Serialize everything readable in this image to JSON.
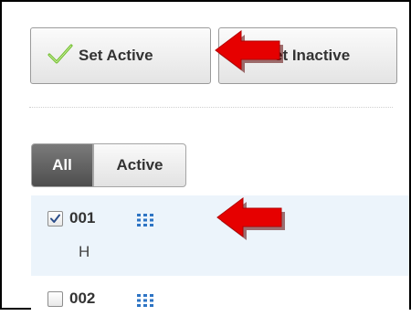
{
  "toolbar": {
    "set_active_label": "Set Active",
    "set_inactive_label": "et Inactive"
  },
  "filter": {
    "options": [
      "All",
      "Active"
    ],
    "selected": "All"
  },
  "rows": [
    {
      "id": "001",
      "subtitle": "H",
      "checked": true,
      "icon": "grid-icon"
    },
    {
      "id": "002",
      "subtitle": "",
      "checked": false,
      "icon": "grid-icon"
    }
  ],
  "annotations": {
    "arrow_color": "#e60000",
    "count": 2
  },
  "colors": {
    "check_green": "#6abb26",
    "icon_blue": "#2d74c4",
    "selected_row_bg": "#ecf4fb",
    "filter_selected_bg": "#5e5e5e"
  }
}
